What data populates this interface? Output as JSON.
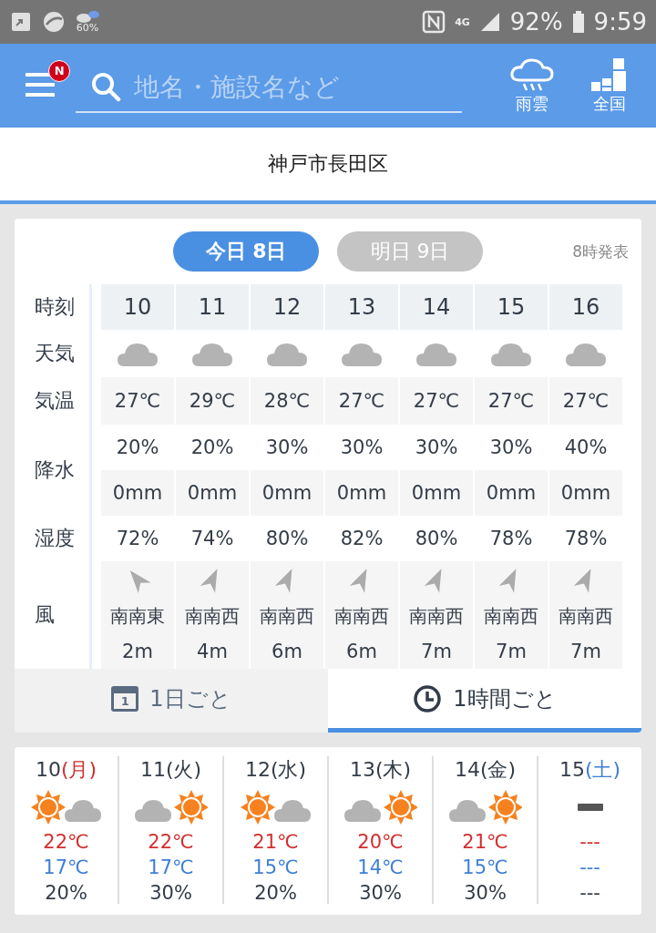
{
  "status_bar": {
    "weather_percent": "60%",
    "network": "4G",
    "battery": "92%",
    "time": "9:59"
  },
  "header": {
    "menu_badge": "N",
    "search": {
      "placeholder": "地名・施設名など"
    },
    "buttons": [
      {
        "kind": "rain",
        "label": "雨雲"
      },
      {
        "kind": "map",
        "label": "全国"
      }
    ]
  },
  "location": "神戸市長田区",
  "hourly": {
    "day_tabs": [
      {
        "label": "今日 8日",
        "selected": true
      },
      {
        "label": "明日 9日",
        "selected": false
      }
    ],
    "issued": "8時発表",
    "row_labels": {
      "time": "時刻",
      "weather": "天気",
      "temp": "気温",
      "precip": "降水",
      "humidity": "湿度",
      "wind": "風"
    },
    "hours": [
      {
        "time": "10",
        "kind": "cloudy",
        "temp": "27℃",
        "precip_chance": "20%",
        "precip_amount": "0mm",
        "humidity": "72%",
        "wind": {
          "kind": "nw",
          "direction": "南南東",
          "speed": "2m"
        }
      },
      {
        "time": "11",
        "kind": "cloudy",
        "temp": "29℃",
        "precip_chance": "20%",
        "precip_amount": "0mm",
        "humidity": "74%",
        "wind": {
          "kind": "ne",
          "direction": "南南西",
          "speed": "4m"
        }
      },
      {
        "time": "12",
        "kind": "cloudy",
        "temp": "28℃",
        "precip_chance": "30%",
        "precip_amount": "0mm",
        "humidity": "80%",
        "wind": {
          "kind": "ne",
          "direction": "南南西",
          "speed": "6m"
        }
      },
      {
        "time": "13",
        "kind": "cloudy",
        "temp": "27℃",
        "precip_chance": "30%",
        "precip_amount": "0mm",
        "humidity": "82%",
        "wind": {
          "kind": "ne",
          "direction": "南南西",
          "speed": "6m"
        }
      },
      {
        "time": "14",
        "kind": "cloudy",
        "temp": "27℃",
        "precip_chance": "30%",
        "precip_amount": "0mm",
        "humidity": "80%",
        "wind": {
          "kind": "ne",
          "direction": "南南西",
          "speed": "7m"
        }
      },
      {
        "time": "15",
        "kind": "cloudy",
        "temp": "27℃",
        "precip_chance": "30%",
        "precip_amount": "0mm",
        "humidity": "78%",
        "wind": {
          "kind": "ne",
          "direction": "南南西",
          "speed": "7m"
        }
      },
      {
        "time": "16",
        "kind": "cloudy",
        "temp": "27℃",
        "precip_chance": "40%",
        "precip_amount": "0mm",
        "humidity": "78%",
        "wind": {
          "kind": "ne",
          "direction": "南南西",
          "speed": "7m"
        }
      }
    ]
  },
  "view_tabs": [
    {
      "kind": "calendar",
      "calendar_day": "1",
      "label": "1日ごと",
      "selected": false
    },
    {
      "kind": "clock",
      "label": "1時間ごと",
      "selected": true
    }
  ],
  "weekly": [
    {
      "day": "10",
      "weekday": "(月)",
      "color": "#d32f2f",
      "kind": "sun-cloud",
      "high": "22℃",
      "low": "17℃",
      "precip": "20%"
    },
    {
      "day": "11",
      "weekday": "(火)",
      "color": "#333c48",
      "kind": "cloud-sun",
      "high": "22℃",
      "low": "17℃",
      "precip": "30%"
    },
    {
      "day": "12",
      "weekday": "(水)",
      "color": "#333c48",
      "kind": "sun-cloud",
      "high": "21℃",
      "low": "15℃",
      "precip": "20%"
    },
    {
      "day": "13",
      "weekday": "(木)",
      "color": "#333c48",
      "kind": "cloud-sun",
      "high": "20℃",
      "low": "14℃",
      "precip": "30%"
    },
    {
      "day": "14",
      "weekday": "(金)",
      "color": "#333c48",
      "kind": "cloud-sun",
      "high": "21℃",
      "low": "15℃",
      "precip": "30%"
    },
    {
      "day": "15",
      "weekday": "(土)",
      "color": "#3f7fd6",
      "kind": "none",
      "high": "---",
      "low": "---",
      "precip": "---"
    }
  ]
}
